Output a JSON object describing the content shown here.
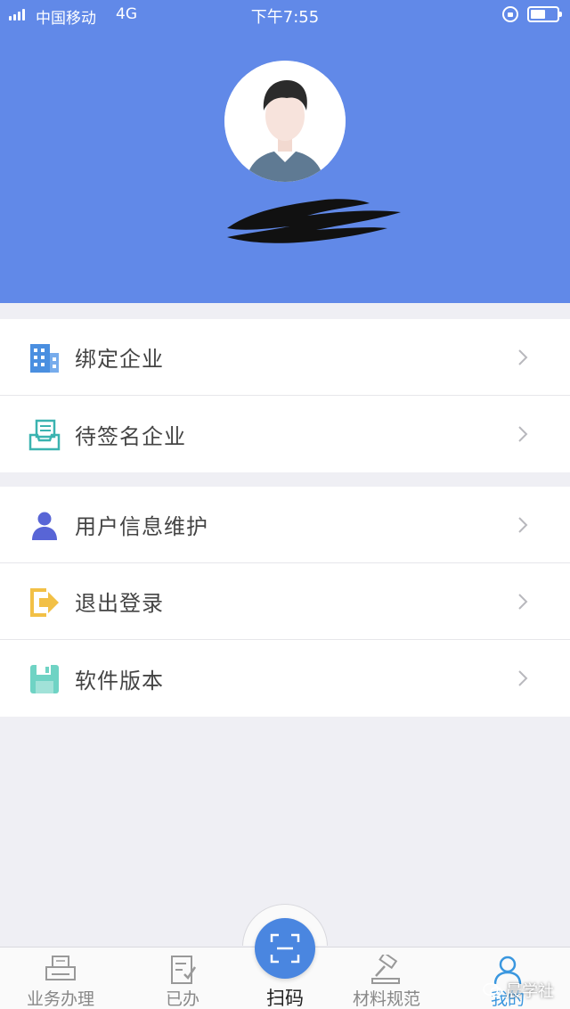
{
  "status_bar": {
    "carrier": "中国移动",
    "network": "4G",
    "time": "下午7:55",
    "battery_level": 0.45
  },
  "profile": {
    "avatar_icon": "user-avatar-icon",
    "username_redacted": true
  },
  "menu": {
    "group1": [
      {
        "label": "绑定企业",
        "icon": "building-icon",
        "color": "#4a8fe0"
      },
      {
        "label": "待签名企业",
        "icon": "document-tray-icon",
        "color": "#3bb3b0"
      }
    ],
    "group2": [
      {
        "label": "用户信息维护",
        "icon": "person-icon",
        "color": "#5865d6"
      },
      {
        "label": "退出登录",
        "icon": "logout-icon",
        "color": "#f2c046"
      },
      {
        "label": "软件版本",
        "icon": "floppy-disk-icon",
        "color": "#6fd3c4"
      }
    ]
  },
  "tab_bar": {
    "tabs": [
      {
        "label": "业务办理",
        "icon": "printer-icon"
      },
      {
        "label": "已办",
        "icon": "checklist-icon"
      },
      {
        "label": "扫码",
        "icon": "scan-icon"
      },
      {
        "label": "材料规范",
        "icon": "gavel-icon"
      },
      {
        "label": "我的",
        "icon": "user-outline-icon",
        "active": true
      }
    ]
  },
  "watermark": "晨学社",
  "colors": {
    "header_bg": "#6189e8",
    "accent": "#3a97df",
    "scan_button": "#4a86e0"
  }
}
